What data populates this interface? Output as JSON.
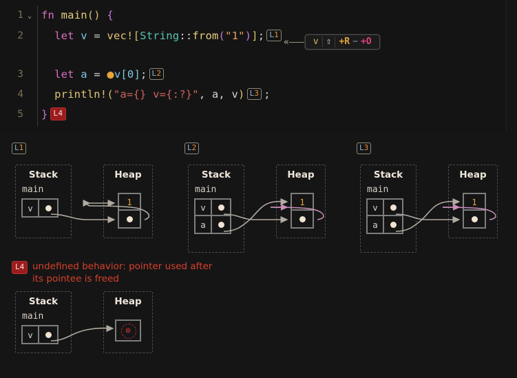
{
  "editor": {
    "lines": [
      {
        "num": "1",
        "fold": "⌄"
      },
      {
        "num": "2",
        "fold": ""
      },
      {
        "num": "3",
        "fold": ""
      },
      {
        "num": "4",
        "fold": ""
      },
      {
        "num": "5",
        "fold": ""
      }
    ],
    "code": {
      "l1_fn": "fn",
      "l1_main": "main",
      "l1_parens": "()",
      "l1_brace": "{",
      "l2_let": "let",
      "l2_v": "v",
      "l2_eq": "=",
      "l2_vec": "vec!",
      "l2_lb": "[",
      "l2_string": "String",
      "l2_colons": "::",
      "l2_from": "from",
      "l2_lp": "(",
      "l2_str": "\"1\"",
      "l2_rp": ")",
      "l2_rb": "]",
      "l2_semi": ";",
      "l3_let": "let",
      "l3_a": "a",
      "l3_eq": "=",
      "l3_dot": "●",
      "l3_v0": "v[0]",
      "l3_semi": ";",
      "l4_println": "println!",
      "l4_lp": "(",
      "l4_fmt": "\"a={} v={:?}\"",
      "l4_args": ", a, v",
      "l4_rp": ")",
      "l4_semi": ";",
      "l5_brace": "}"
    },
    "badges": {
      "L1": {
        "letter": "L",
        "number": "1"
      },
      "L2": {
        "letter": "L",
        "number": "2"
      },
      "L3": {
        "letter": "L",
        "number": "3"
      },
      "L4": {
        "letter": "L",
        "number": "4"
      }
    }
  },
  "permissions_tooltip": {
    "lead": "«",
    "path": "v",
    "move_glyph": "⇧",
    "read": "+R",
    "write": "−",
    "own": "+O",
    "read_plus": "+",
    "read_letter": "R",
    "own_plus": "+",
    "own_letter": "O"
  },
  "diagrams": [
    {
      "id": "L1",
      "badge": {
        "letter": "L",
        "number": "1"
      },
      "stack": {
        "title": "Stack",
        "frame": "main",
        "cells": [
          {
            "name": "v",
            "value": "pointer-dot"
          }
        ]
      },
      "heap": {
        "title": "Heap",
        "cells": [
          {
            "value": "1"
          },
          {
            "value": "pointer-dot"
          }
        ]
      }
    },
    {
      "id": "L2",
      "badge": {
        "letter": "L",
        "number": "2"
      },
      "stack": {
        "title": "Stack",
        "frame": "main",
        "cells": [
          {
            "name": "v",
            "value": "pointer-dot"
          },
          {
            "name": "a",
            "value": "pointer-dot"
          }
        ]
      },
      "heap": {
        "title": "Heap",
        "cells": [
          {
            "value": "1"
          },
          {
            "value": "pointer-dot"
          }
        ]
      }
    },
    {
      "id": "L3",
      "badge": {
        "letter": "L",
        "number": "3"
      },
      "stack": {
        "title": "Stack",
        "frame": "main",
        "cells": [
          {
            "name": "v",
            "value": "pointer-dot"
          },
          {
            "name": "a",
            "value": "pointer-dot"
          }
        ]
      },
      "heap": {
        "title": "Heap",
        "cells": [
          {
            "value": "1"
          },
          {
            "value": "pointer-dot"
          }
        ]
      }
    }
  ],
  "l4_section": {
    "badge": {
      "letter": "L",
      "number": "4"
    },
    "message_line1": "undefined behavior: pointer used after",
    "message_line2": "its pointee is freed",
    "stack": {
      "title": "Stack",
      "frame": "main",
      "cells": [
        {
          "name": "v",
          "value": "pointer-dot"
        }
      ]
    },
    "heap": {
      "title": "Heap",
      "freed_glyph": "⊗"
    }
  },
  "colors": {
    "background": "#151515",
    "editor_background": "#141414",
    "error_red": "#d9402c",
    "badge_red": "#9b1c1c",
    "arrow_gray": "#b0aaa0",
    "arrow_pink": "#c98fb8",
    "accent_orange": "#e8a33d",
    "keyword_pink": "#d96fc0"
  }
}
